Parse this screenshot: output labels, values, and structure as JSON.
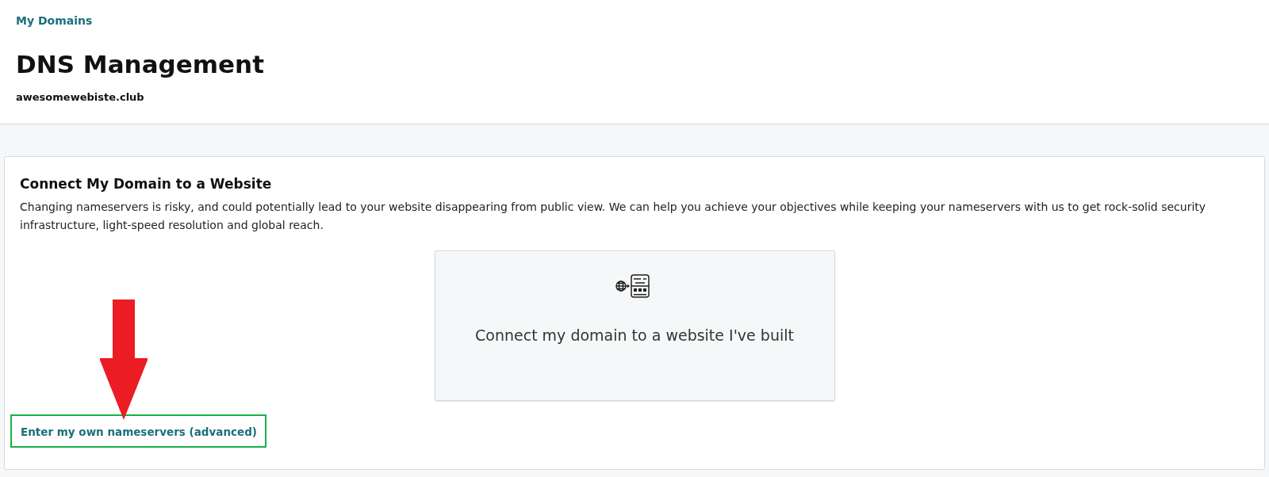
{
  "breadcrumb": "My Domains",
  "title": "DNS Management",
  "domain": "awesomewebiste.club",
  "section": {
    "title": "Connect My Domain to a Website",
    "description": "Changing nameservers is risky, and could potentially lead to your website disappearing from public view. We can help you achieve your objectives while keeping your nameservers with us to get rock-solid security infrastructure, light-speed resolution and global reach."
  },
  "options": [
    {
      "label": "Connect my domain to a website I've built"
    }
  ],
  "advanced_link": "Enter my own nameservers (advanced)"
}
